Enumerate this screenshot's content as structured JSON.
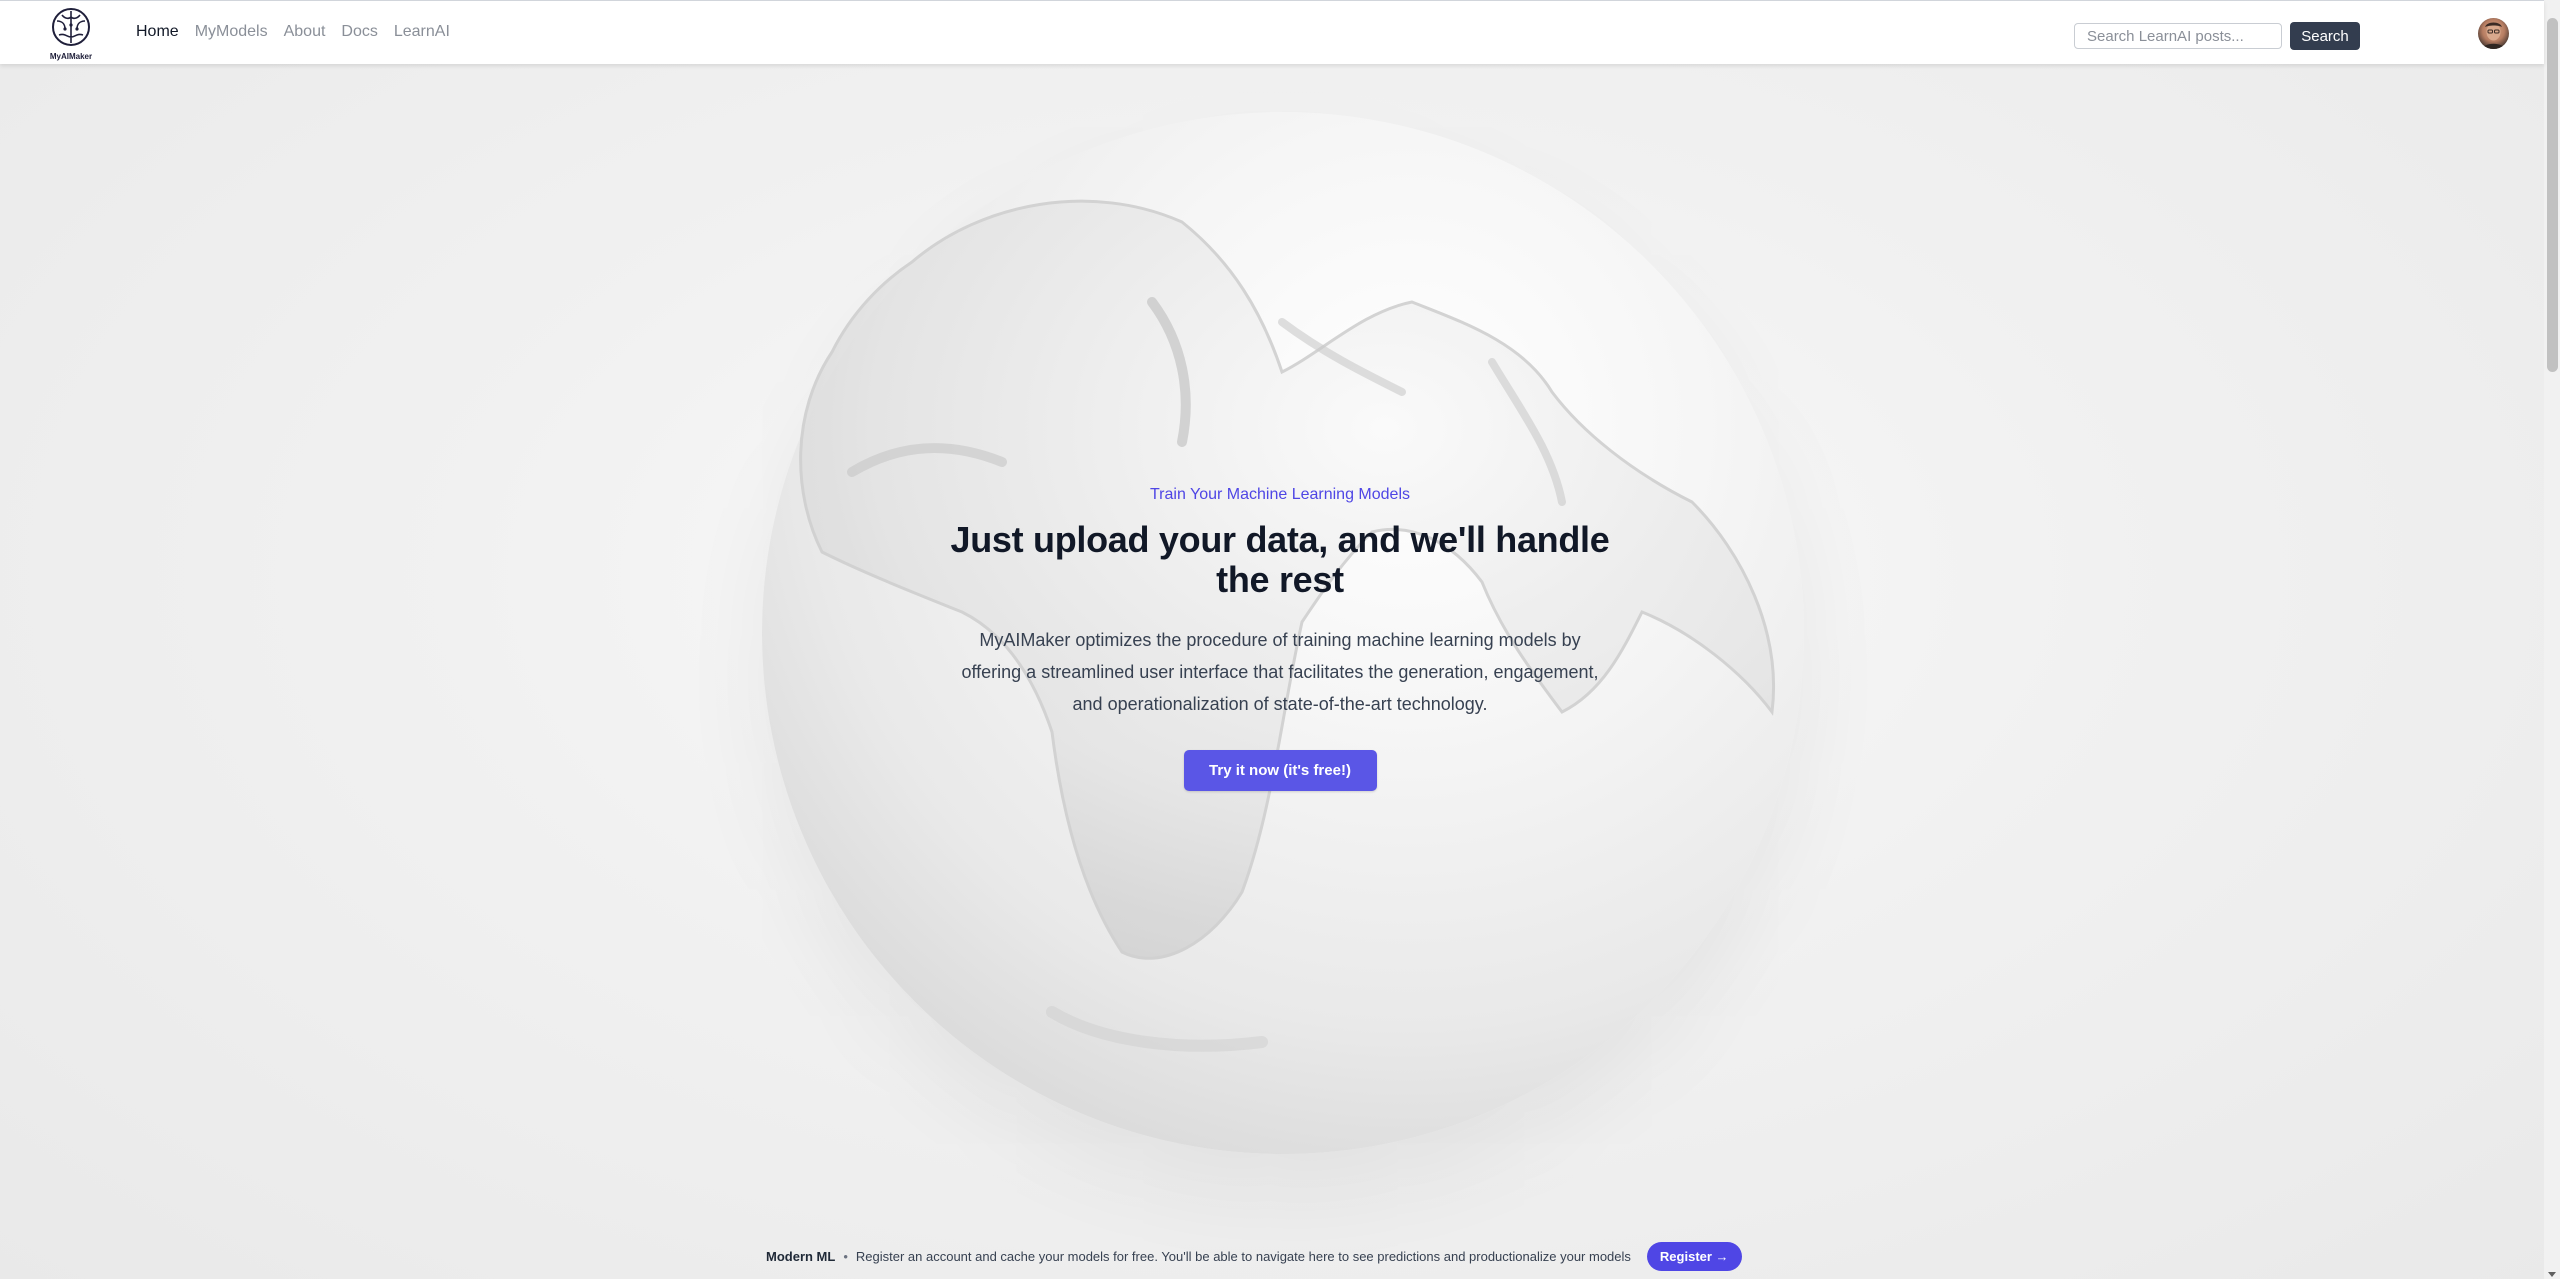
{
  "nav": {
    "logo_text": "MyAIMaker",
    "links": [
      {
        "label": "Home",
        "active": true
      },
      {
        "label": "MyModels",
        "active": false
      },
      {
        "label": "About",
        "active": false
      },
      {
        "label": "Docs",
        "active": false
      },
      {
        "label": "LearnAI",
        "active": false
      }
    ],
    "search_placeholder": "Search LearnAI posts...",
    "search_button": "Search"
  },
  "hero": {
    "eyebrow": "Train Your Machine Learning Models",
    "headline": "Just upload your data, and we'll handle the rest",
    "description": "MyAIMaker optimizes the procedure of training machine learning models by offering a streamlined user interface that facilitates the generation, engagement, and operationalization of state-of-the-art technology.",
    "cta": "Try it now (it's free!)"
  },
  "banner": {
    "title": "Modern ML",
    "separator": "•",
    "text": "Register an account and cache your models for free. You'll be able to navigate here to see predictions and productionalize your models",
    "button": "Register →"
  },
  "colors": {
    "accent": "#4f46e5",
    "search_button": "#333d4f",
    "heading": "#111827"
  }
}
